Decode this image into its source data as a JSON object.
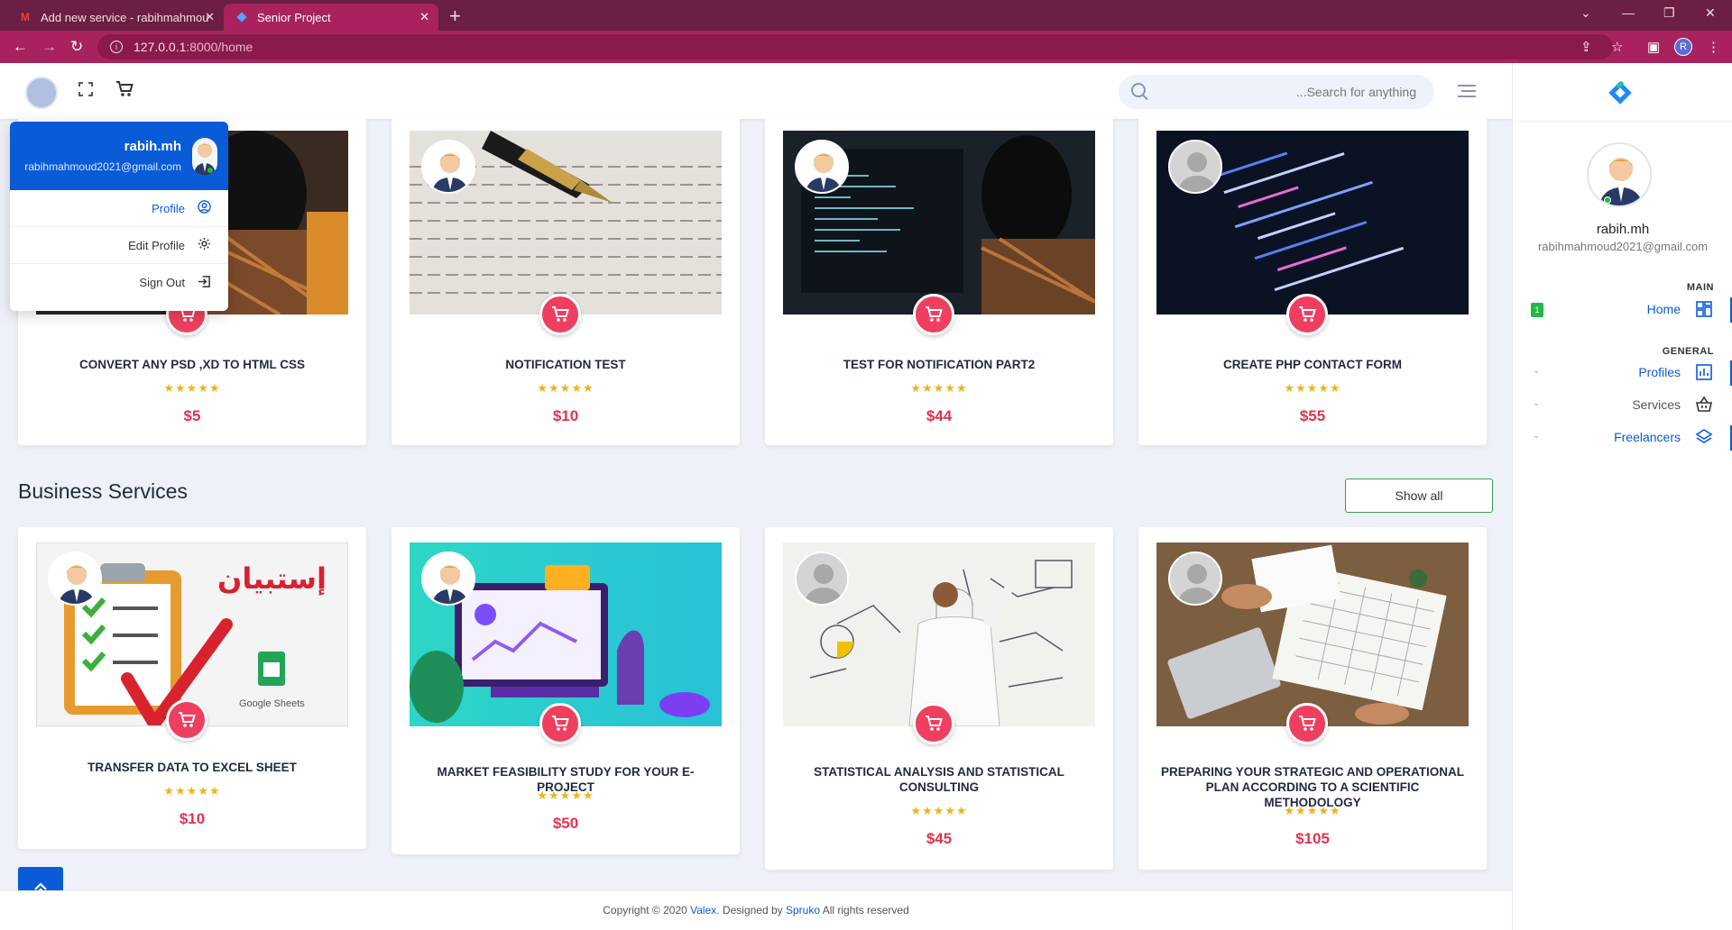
{
  "browser": {
    "tabs": [
      {
        "title": "Add new service - rabihmahmou"
      },
      {
        "title": "Senior Project"
      }
    ],
    "url_host": "127.0.0.1",
    "url_rest": ":8000/home",
    "profile_initial": "R"
  },
  "header": {
    "search_placeholder": "...Search for anything"
  },
  "user_menu": {
    "name": "rabih.mh",
    "email": "rabihmahmoud2021@gmail.com",
    "items": [
      {
        "label": "Profile"
      },
      {
        "label": "Edit Profile"
      },
      {
        "label": "Sign Out"
      }
    ]
  },
  "top_services": [
    {
      "title": "CONVERT ANY PSD ,XD TO HTML CSS",
      "stars": "★★★★★",
      "price": "$5"
    },
    {
      "title": "NOTIFICATION TEST",
      "stars": "★★★★★",
      "price": "$10"
    },
    {
      "title": "TEST FOR NOTIFICATION PART2",
      "stars": "★★★★★",
      "price": "$44"
    },
    {
      "title": "CREATE PHP CONTACT FORM",
      "stars": "★★★★★",
      "price": "$55"
    }
  ],
  "business": {
    "section_title": "Business Services",
    "show_all": "Show all",
    "services": [
      {
        "title": "TRANSFER DATA TO EXCEL SHEET",
        "stars": "★★★★★",
        "price": "$10",
        "image_text": "إستبيان",
        "image_caption": "Google Sheets"
      },
      {
        "title": "MARKET FEASIBILITY STUDY FOR YOUR E-PROJECT",
        "stars": "★★★★★",
        "price": "$50"
      },
      {
        "title": "STATISTICAL ANALYSIS AND STATISTICAL CONSULTING",
        "stars": "★★★★★",
        "price": "$45"
      },
      {
        "title": "PREPARING YOUR STRATEGIC AND OPERATIONAL PLAN ACCORDING TO A SCIENTIFIC METHODOLOGY",
        "stars": "★★★★★",
        "price": "$105"
      }
    ]
  },
  "footer": {
    "prefix": "Copyright © 2020 ",
    "brand": "Valex",
    "mid": ". Designed by ",
    "designer": "Spruko",
    "suffix": " All rights reserved"
  },
  "sidebar": {
    "name": "rabih.mh",
    "email": "rabihmahmoud2021@gmail.com",
    "main_label": "MAIN",
    "general_label": "GENERAL",
    "home_badge": "1",
    "items": [
      {
        "label": "Home"
      },
      {
        "label": "Profiles"
      },
      {
        "label": "Services"
      },
      {
        "label": "Freelancers"
      }
    ]
  },
  "colors": {
    "accent": "#0a5bd8",
    "cart": "#ef3f60",
    "price": "#e0344e",
    "star": "#f0b21a",
    "chrome": "#a8235e"
  }
}
